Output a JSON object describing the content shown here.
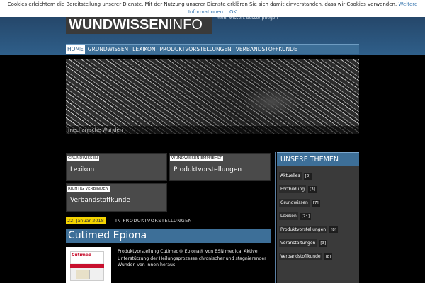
{
  "cookie": {
    "text": "Cookies erleichtern die Bereitstellung unserer Dienste. Mit der Nutzung unserer Dienste erklären Sie sich damit einverstanden, dass wir Cookies verwenden.",
    "more_link": "Weitere Informationen",
    "ok_link": "OK"
  },
  "header": {
    "logo_bold": "WUNDWISSEN",
    "logo_light": "INFO",
    "tagline": "mehr wissen, besser pflegen"
  },
  "nav": {
    "items": [
      {
        "label": "HOME"
      },
      {
        "label": "GRUNDWISSEN"
      },
      {
        "label": "LEXIKON"
      },
      {
        "label": "PRODUKTVORSTELLUNGEN"
      },
      {
        "label": "VERBANDSTOFFKUNDE"
      }
    ]
  },
  "hero": {
    "caption": "mechanische Wunden"
  },
  "boxes": [
    {
      "label": "GRUNDWISSEN",
      "title": "Lexikon"
    },
    {
      "label": "WUNDWISSEN EMPFIEHLT",
      "title": "Produktvorstellungen"
    },
    {
      "label": "RICHTIG VERBINDEN",
      "title": "Verbandstoffkunde"
    }
  ],
  "sidebar": {
    "heading": "UNSERE THEMEN",
    "items": [
      {
        "name": "Aktuelles",
        "count": "[3]"
      },
      {
        "name": "Fortbildung",
        "count": "[3]"
      },
      {
        "name": "Grundwissen",
        "count": "[7]"
      },
      {
        "name": "Lexikon",
        "count": "[74]"
      },
      {
        "name": "Produktvorstellungen",
        "count": "[8]"
      },
      {
        "name": "Veranstaltungen",
        "count": "[3]"
      },
      {
        "name": "Verbandstoffkunde",
        "count": "[8]"
      }
    ]
  },
  "post": {
    "date": "22. Januar 2018",
    "category": "IN PRODUKTVORSTELLUNGEN",
    "title": "Cutimed Epiona",
    "excerpt": "Produktvorstellung Cutimed® Epiona® von BSN medical Aktive Unterstützung der Heilungsprozesse chronischer und stagnierender Wunden von innen heraus",
    "product_brand": "Cutimed"
  },
  "colors": {
    "accent_blue": "#3d6f98",
    "date_yellow": "#f5d400",
    "brand_red": "#c8102e"
  }
}
